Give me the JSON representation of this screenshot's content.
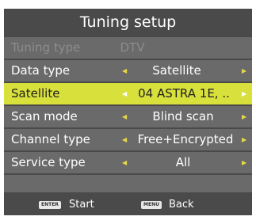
{
  "title": "Tuning setup",
  "rows": [
    {
      "label": "Tuning type",
      "value": "DTV"
    },
    {
      "label": "Data type",
      "value": "Satellite"
    },
    {
      "label": "Satellite",
      "value": "04 ASTRA 1E, .."
    },
    {
      "label": "Scan mode",
      "value": "Blind scan"
    },
    {
      "label": "Channel type",
      "value": "Free+Encrypted"
    },
    {
      "label": "Service type",
      "value": "All"
    }
  ],
  "footer": {
    "enter_key": "ENTER",
    "enter_label": "Start",
    "menu_key": "MENU",
    "menu_label": "Back"
  },
  "colors": {
    "panel": "#4a4a4a",
    "row": "#6a6a6a",
    "highlight": "#d8e03c",
    "arrow": "#e6d84a",
    "disabled_text": "#8c8c8c"
  },
  "icons": {
    "left_arrow": "triangle-left-icon",
    "right_arrow": "triangle-right-icon"
  }
}
